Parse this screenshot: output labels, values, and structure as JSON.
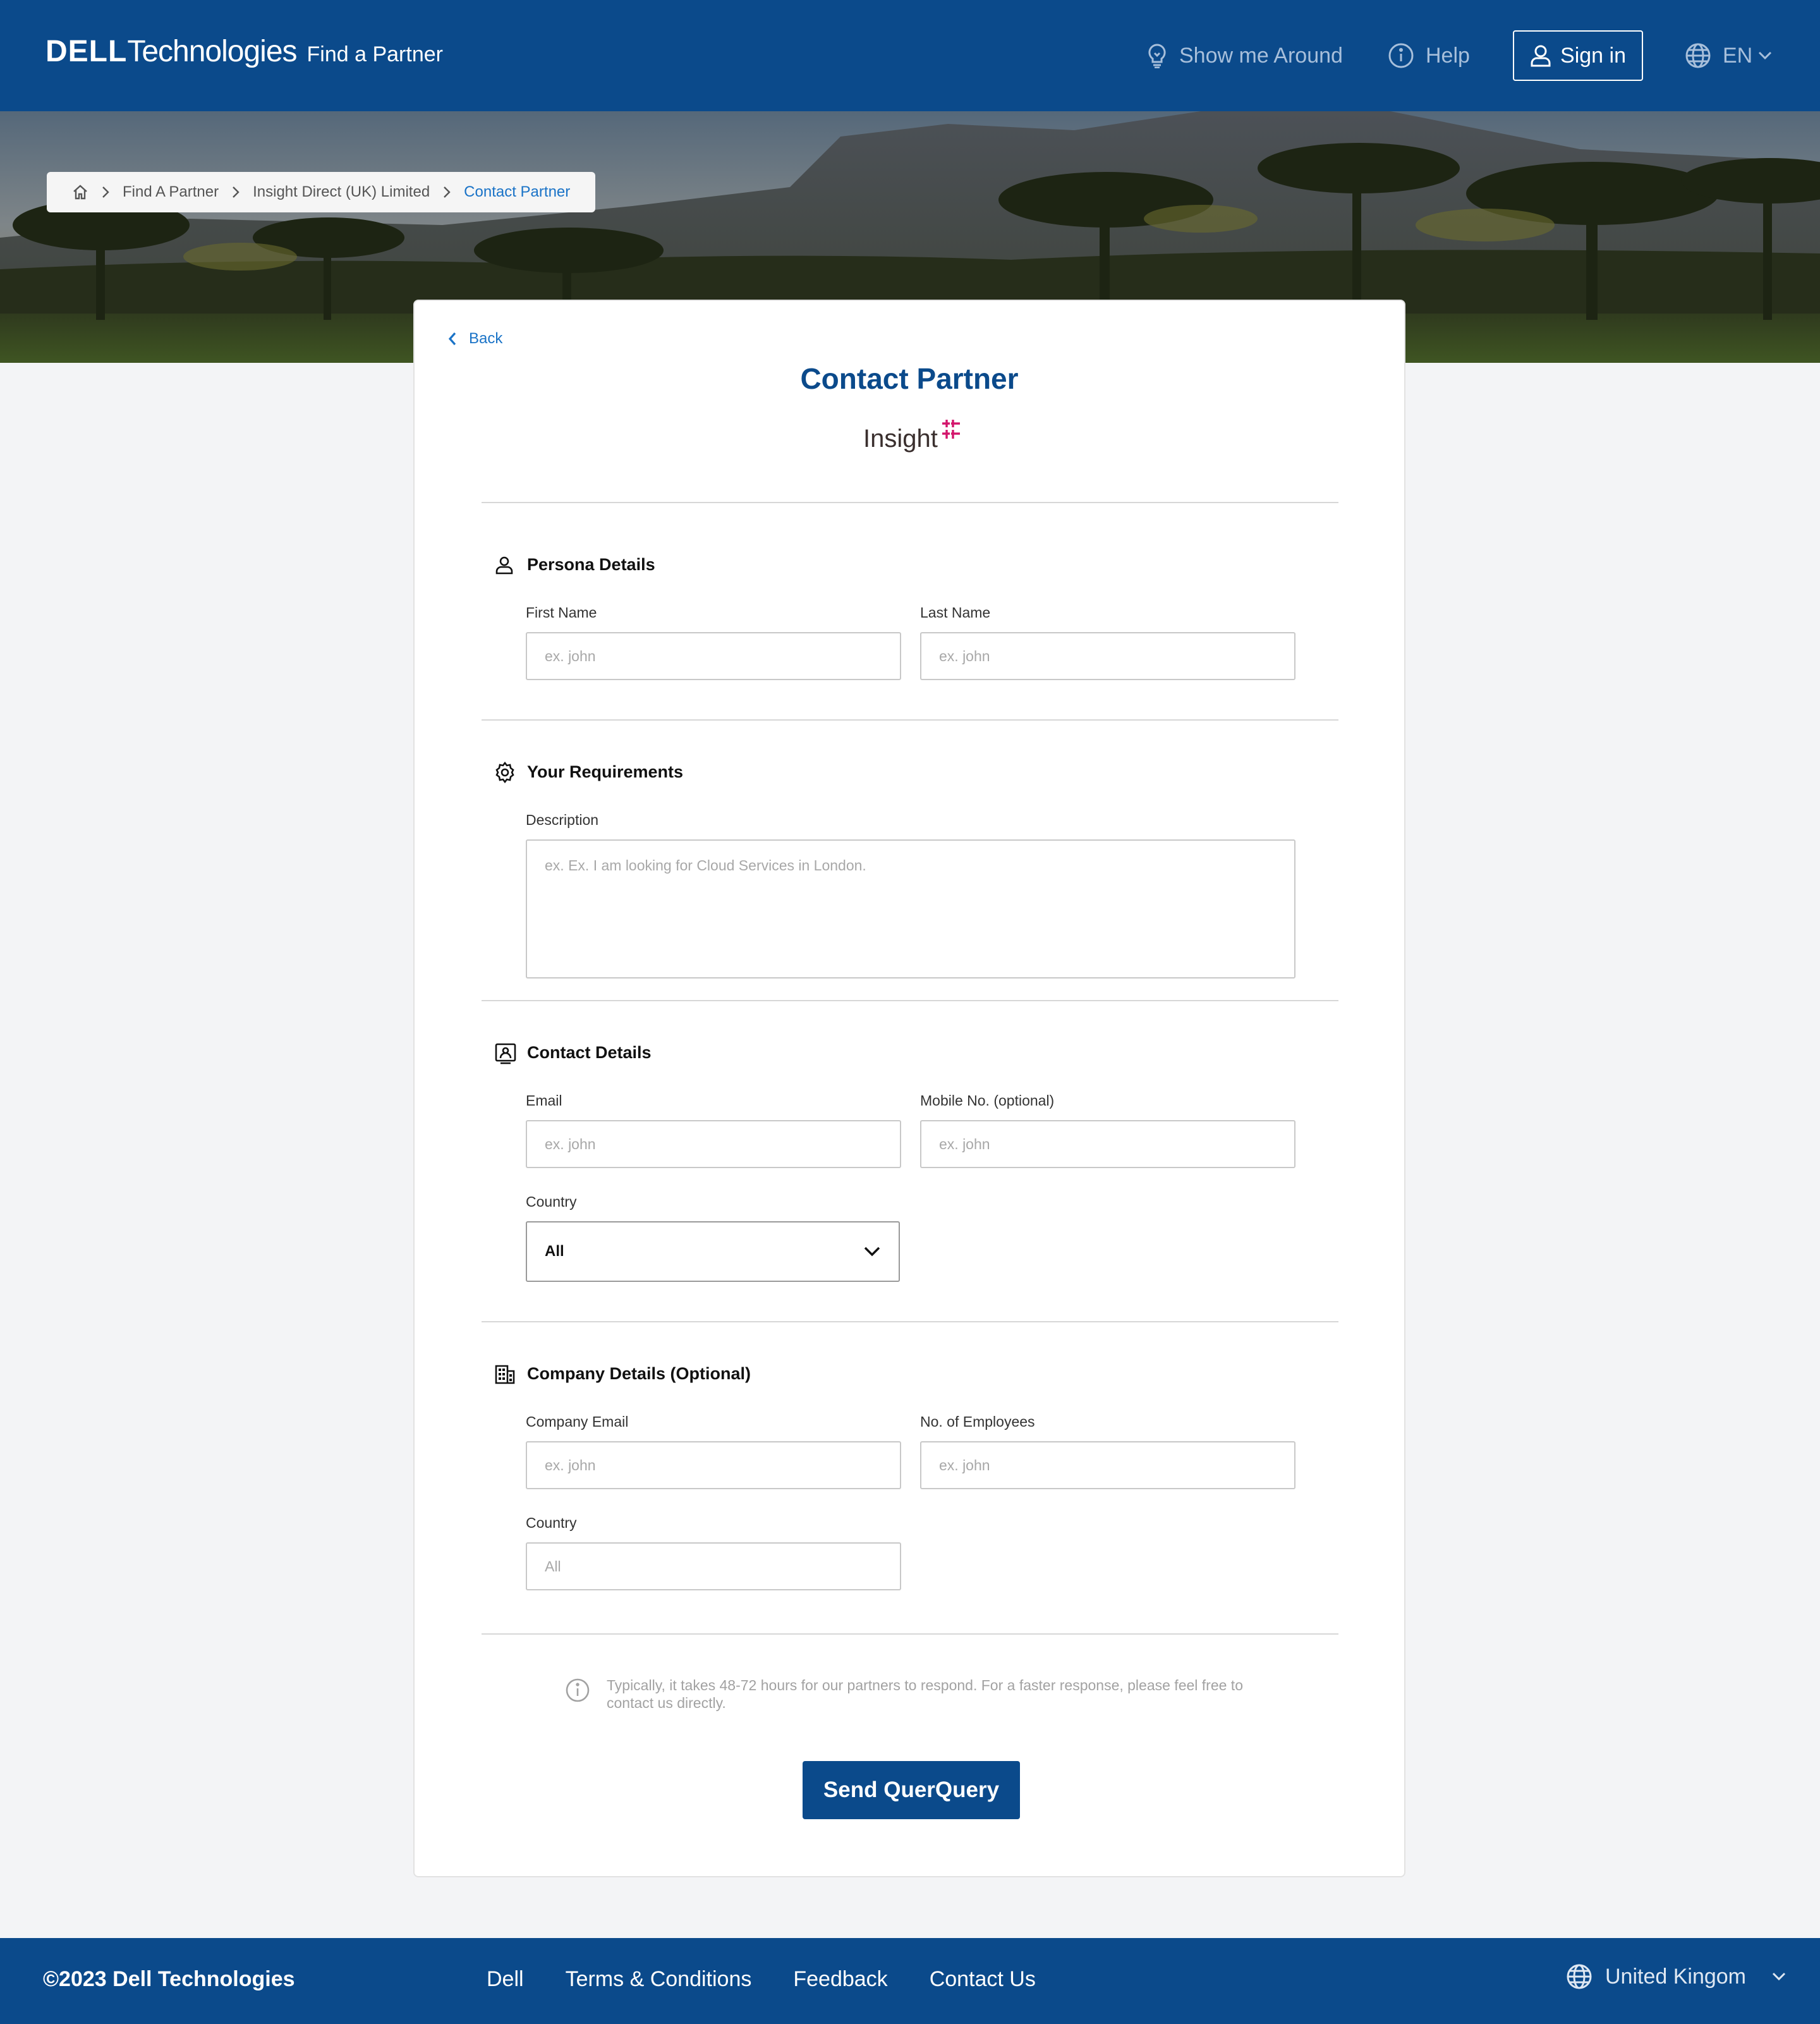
{
  "header": {
    "brand_dell": "DELL",
    "brand_tech": "Technologies",
    "app_title": "Find a Partner",
    "show_around": "Show me Around",
    "help": "Help",
    "sign_in": "Sign in",
    "language": "EN"
  },
  "breadcrumb": {
    "items": [
      "Find A Partner",
      "Insight Direct (UK) Limited",
      "Contact Partner"
    ]
  },
  "card": {
    "back": "Back",
    "title": "Contact Partner",
    "partner_logo_text": "Insight"
  },
  "persona": {
    "heading": "Persona Details",
    "first_name_label": "First Name",
    "first_name_placeholder": "ex. john",
    "last_name_label": "Last Name",
    "last_name_placeholder": "ex. john"
  },
  "requirements": {
    "heading": "Your Requirements",
    "description_label": "Description",
    "description_placeholder": "ex. Ex. I am looking for Cloud Services in London."
  },
  "contact": {
    "heading": "Contact Details",
    "email_label": "Email",
    "email_placeholder": "ex. john",
    "mobile_label": "Mobile No. (optional)",
    "mobile_placeholder": "ex. john",
    "country_label": "Country",
    "country_value": "All"
  },
  "company": {
    "heading": "Company Details (Optional)",
    "email_label": "Company Email",
    "email_placeholder": "ex. john",
    "employees_label": "No. of Employees",
    "employees_placeholder": "ex. john",
    "country_label": "Country",
    "country_placeholder": "All"
  },
  "info_text": "Typically, it takes 48-72 hours for our partners to respond. For a faster response, please feel free to contact us directly.",
  "send_button": "Send QuerQuery",
  "footer": {
    "copyright": "©2023 Dell Technologies",
    "links": [
      "Dell",
      "Terms & Conditions",
      "Feedback",
      "Contact Us"
    ],
    "region": "United Kingom"
  },
  "colors": {
    "brand_blue": "#0b4a8b",
    "link_blue": "#1a73c7",
    "insight_accent": "#d3156b"
  }
}
